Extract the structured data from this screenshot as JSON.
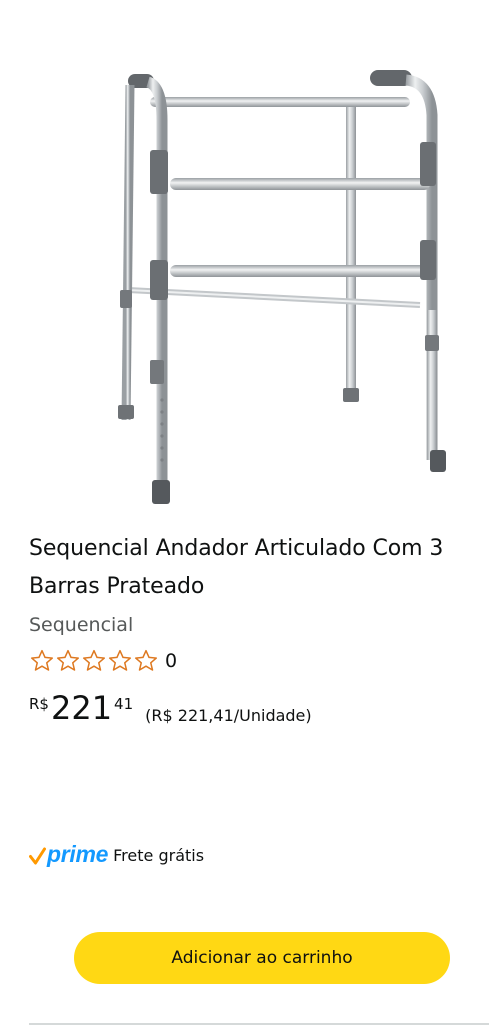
{
  "product": {
    "title": "Sequencial Andador Articulado Com 3 Barras Prateado",
    "brand": "Sequencial",
    "image_icon": "walker-product-image",
    "rating": {
      "stars": 0,
      "max_stars": 5,
      "count": "0",
      "star_color": "#de7921"
    },
    "price": {
      "symbol": "R$",
      "whole": "221",
      "fraction": "41",
      "unit_price": "(R$ 221,41/Unidade)"
    },
    "delivery": {
      "prime_label": "prime",
      "prime_color": "#1399ff",
      "check_color": "#ff9900",
      "shipping": "Frete grátis"
    },
    "add_to_cart_label": "Adicionar ao carrinho",
    "button_color": "#ffd814"
  }
}
